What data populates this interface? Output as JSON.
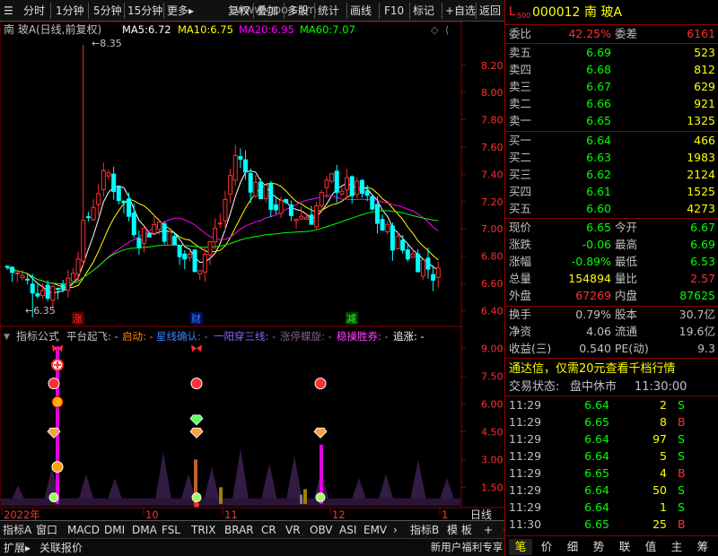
{
  "toolbar": {
    "left_items": [
      "分时",
      "1分钟",
      "5分钟",
      "15分钟",
      "更多▸"
    ],
    "right_items": [
      "复权",
      "叠加",
      "多股",
      "统计",
      "画线",
      "F10",
      "标记",
      "+自选",
      "返回"
    ],
    "watermark": "www.goo.com"
  },
  "main_chart": {
    "title_stock": "南 玻A",
    "title_mode": "(日线,前复权)",
    "ma": [
      {
        "label": "MA5:",
        "value": "6.72",
        "color": "#ffffff"
      },
      {
        "label": "MA10:",
        "value": "6.75",
        "color": "#ffff00"
      },
      {
        "label": "MA20:",
        "value": "6.95",
        "color": "#ff00ff"
      },
      {
        "label": "MA60:",
        "value": "7.07",
        "color": "#00ff00"
      }
    ],
    "y_ticks": [
      "8.20",
      "8.00",
      "7.80",
      "7.60",
      "7.40",
      "7.20",
      "7.00",
      "6.80",
      "6.60",
      "6.40"
    ],
    "y_min": 6.35,
    "y_max": 8.35,
    "high_label": "8.35",
    "low_label": "6.35",
    "markers": [
      {
        "text": "涨",
        "color": "#ff3030",
        "bg": "#500000"
      },
      {
        "text": "财",
        "color": "#4080ff",
        "bg": "#001050"
      },
      {
        "text": "减",
        "color": "#30ff30",
        "bg": "#004000"
      }
    ]
  },
  "indicator": {
    "title": "指标公式",
    "items": [
      {
        "label": "平台起飞:",
        "value": "-",
        "color": "#c0c0c0"
      },
      {
        "label": "启动:",
        "value": "-",
        "color": "#ff8000"
      },
      {
        "label": "星线确认:",
        "value": "-",
        "color": "#4080ff"
      },
      {
        "label": "一阳穿三线:",
        "value": "-",
        "color": "#9060ff"
      },
      {
        "label": "涨停蝶旋:",
        "value": "-",
        "color": "#806080"
      },
      {
        "label": "稳操胜券:",
        "value": "-",
        "color": "#ff40ff"
      },
      {
        "label": "追涨:",
        "value": "-",
        "color": "#ffffff"
      }
    ],
    "y_ticks": [
      "9.00",
      "7.50",
      "6.00",
      "4.50",
      "3.00",
      "1.50"
    ],
    "y_min": 0.5,
    "y_max": 9.5
  },
  "xaxis": {
    "labels": [
      "2022年",
      "10",
      "11",
      "12",
      "1"
    ],
    "right_label": "日线"
  },
  "bottom_tabs": [
    "指标A",
    "窗口",
    "MACD",
    "DMI",
    "DMA",
    "FSL",
    "TRIX",
    "BRAR",
    "CR",
    "VR",
    "OBV",
    "ASI",
    "EMV",
    "›",
    "指标B",
    "模 板",
    "+",
    "−"
  ],
  "bottom_row2": [
    "扩展▸",
    "关联报价"
  ],
  "quote": {
    "code": "000012",
    "name": "南 玻A",
    "webi_label": "委比",
    "webi_value": "42.25%",
    "weicha_label": "委差",
    "weicha_value": "6161",
    "sell": [
      {
        "label": "卖五",
        "price": "6.69",
        "vol": "523"
      },
      {
        "label": "卖四",
        "price": "6.68",
        "vol": "812"
      },
      {
        "label": "卖三",
        "price": "6.67",
        "vol": "629"
      },
      {
        "label": "卖二",
        "price": "6.66",
        "vol": "921"
      },
      {
        "label": "卖一",
        "price": "6.65",
        "vol": "1325"
      }
    ],
    "buy": [
      {
        "label": "买一",
        "price": "6.64",
        "vol": "466"
      },
      {
        "label": "买二",
        "price": "6.63",
        "vol": "1983"
      },
      {
        "label": "买三",
        "price": "6.62",
        "vol": "2124"
      },
      {
        "label": "买四",
        "price": "6.61",
        "vol": "1525"
      },
      {
        "label": "买五",
        "price": "6.60",
        "vol": "4273"
      }
    ],
    "stats": [
      {
        "l1": "现价",
        "v1": "6.65",
        "c1": "#00ff00",
        "l2": "今开",
        "v2": "6.67",
        "c2": "#00ff00"
      },
      {
        "l1": "涨跌",
        "v1": "-0.06",
        "c1": "#00ff00",
        "l2": "最高",
        "v2": "6.69",
        "c2": "#00ff00"
      },
      {
        "l1": "涨幅",
        "v1": "-0.89%",
        "c1": "#00ff00",
        "l2": "最低",
        "v2": "6.53",
        "c2": "#00ff00"
      },
      {
        "l1": "总量",
        "v1": "154894",
        "c1": "#ffff00",
        "l2": "量比",
        "v2": "2.57",
        "c2": "#ff3030"
      },
      {
        "l1": "外盘",
        "v1": "67269",
        "c1": "#ff3030",
        "l2": "内盘",
        "v2": "87625",
        "c2": "#00ff00"
      }
    ],
    "stats2": [
      {
        "l1": "换手",
        "v1": "0.79%",
        "l2": "股本",
        "v2": "30.7亿"
      },
      {
        "l1": "净资",
        "v1": "4.06",
        "l2": "流通",
        "v2": "19.6亿"
      },
      {
        "l1": "收益(三)",
        "v1": "0.540",
        "l2": "PE(动)",
        "v2": "9.3"
      }
    ],
    "promo": "通达信，仅需20元查看千档行情",
    "trade_status_label": "交易状态:",
    "trade_status": "盘中休市",
    "trade_time": "11:30:00",
    "ticks": [
      {
        "time": "11:29",
        "price": "6.64",
        "vol": "2",
        "side": "S"
      },
      {
        "time": "11:29",
        "price": "6.65",
        "vol": "8",
        "side": "B"
      },
      {
        "time": "11:29",
        "price": "6.64",
        "vol": "97",
        "side": "S"
      },
      {
        "time": "11:29",
        "price": "6.64",
        "vol": "5",
        "side": "S"
      },
      {
        "time": "11:29",
        "price": "6.65",
        "vol": "4",
        "side": "B"
      },
      {
        "time": "11:29",
        "price": "6.64",
        "vol": "50",
        "side": "S"
      },
      {
        "time": "11:29",
        "price": "6.64",
        "vol": "1",
        "side": "S"
      },
      {
        "time": "11:30",
        "price": "6.65",
        "vol": "25",
        "side": "B"
      }
    ],
    "tabs": [
      "笔",
      "价",
      "细",
      "势",
      "联",
      "值",
      "主",
      "筹"
    ],
    "newuser_label": "新用户福利专享"
  },
  "colors": {
    "up": "#ff3030",
    "down": "#00ffff",
    "grid": "#8b0000",
    "label": "#c0c0c0"
  }
}
